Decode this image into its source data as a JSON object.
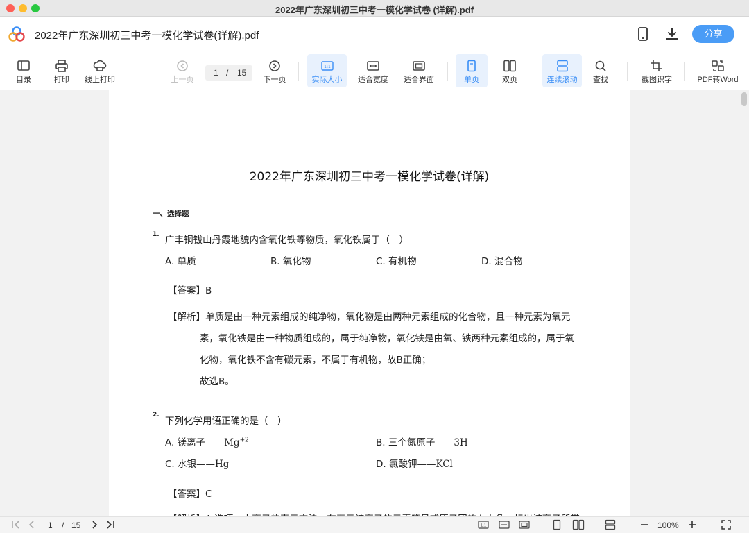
{
  "window": {
    "title": "2022年广东深圳初三中考一模化学试卷 (详解).pdf"
  },
  "header": {
    "filename": "2022年广东深圳初三中考一模化学试卷(详解).pdf",
    "share_label": "分享"
  },
  "toolbar": {
    "toc": "目录",
    "print": "打印",
    "online_print": "线上打印",
    "prev": "上一页",
    "current_page": "1",
    "page_sep": "/",
    "total_pages": "15",
    "next": "下一页",
    "actual_size": "实际大小",
    "fit_width": "适合宽度",
    "fit_page": "适合界面",
    "single_page": "单页",
    "double_page": "双页",
    "continuous_scroll": "连续滚动",
    "find": "查找",
    "ocr": "截图识字",
    "pdf_to_word": "PDF转Word"
  },
  "document": {
    "title": "2022年广东深圳初三中考一模化学试卷(详解)",
    "section": "一、选择题",
    "q1": {
      "number": "1.",
      "stem": "广丰铜钹山丹霞地貌内含氧化铁等物质，氧化铁属于（　）",
      "options": [
        "A. 单质",
        "B. 氧化物",
        "C. 有机物",
        "D. 混合物"
      ],
      "answer_label": "【答案】",
      "answer": "B",
      "analysis_label": "【解析】",
      "analysis_lines": [
        "单质是由一种元素组成的纯净物，氧化物是由两种元素组成的化合物，且一种元素为氧元",
        "素，氧化铁是由一种物质组成的，属于纯净物，氧化铁是由氧、铁两种元素组成的，属于氧",
        "化物，氧化铁不含有碳元素，不属于有机物，故B正确；",
        "故选B。"
      ]
    },
    "q2": {
      "number": "2.",
      "stem": "下列化学用语正确的是（　）",
      "options": [
        {
          "label": "A. 镁离子——",
          "formula": "Mg",
          "sup": "+2"
        },
        {
          "label": "B. 三个氮原子——",
          "formula": "3H",
          "sup": ""
        },
        {
          "label": "C. 水银——",
          "formula": "Hg",
          "sup": ""
        },
        {
          "label": "D. 氯酸钾——",
          "formula": "KCl",
          "sup": ""
        }
      ],
      "answer_label": "【答案】",
      "answer": "C",
      "analysis_partial": "【解析】A.选项：由离子的表示方法，在表示该离子的元素符号或原子团的右上角，标出该离子所带"
    }
  },
  "bottom": {
    "current_page": "1",
    "page_sep": "/",
    "total_pages": "15",
    "zoom": "100%"
  },
  "colors": {
    "accent": "#4a9cf6",
    "active_bg": "#e8f1fd",
    "active_text": "#3a8ef6"
  }
}
